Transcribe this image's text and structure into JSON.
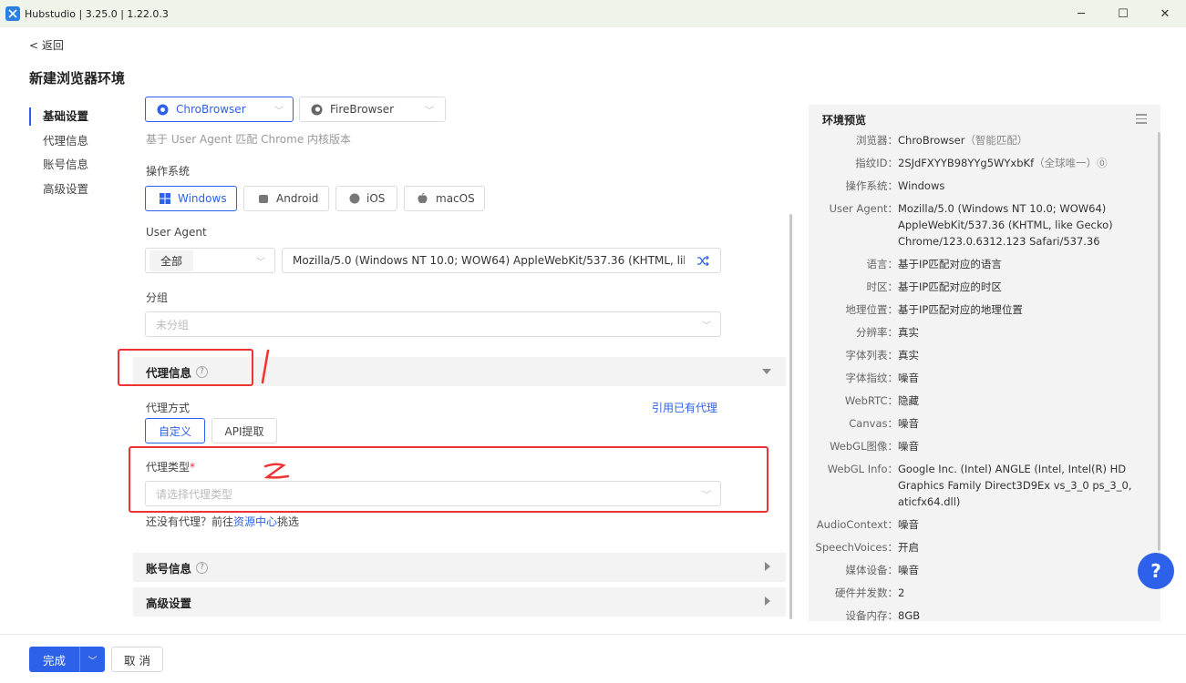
{
  "window": {
    "title": "Hubstudio | 3.25.0 | 1.22.0.3",
    "minimize": "─",
    "maximize": "☐",
    "close": "✕"
  },
  "nav": {
    "back": "< 返回",
    "page_title": "新建浏览器环境",
    "items": [
      "基础设置",
      "代理信息",
      "账号信息",
      "高级设置"
    ]
  },
  "browser": {
    "options": [
      "ChroBrowser",
      "FireBrowser"
    ],
    "hint": "基于 User Agent 匹配 Chrome 内核版本"
  },
  "os": {
    "label": "操作系统",
    "options": [
      "Windows",
      "Android",
      "iOS",
      "macOS"
    ]
  },
  "user_agent": {
    "label": "User Agent",
    "filter": "全部",
    "value": "Mozilla/5.0 (Windows NT 10.0; WOW64) AppleWebKit/537.36 (KHTML, like Gec"
  },
  "group": {
    "label": "分组",
    "placeholder": "未分组"
  },
  "proxy": {
    "section_title": "代理信息",
    "method_label": "代理方式",
    "use_existing": "引用已有代理",
    "methods": [
      "自定义",
      "API提取"
    ],
    "type_label": "代理类型",
    "required": "*",
    "type_placeholder": "请选择代理类型",
    "no_proxy_prefix": "还没有代理？前往",
    "no_proxy_link": "资源中心",
    "no_proxy_suffix": "挑选"
  },
  "annotations": {
    "mark1": "1",
    "mark2": "2"
  },
  "sections": {
    "account": "账号信息",
    "advanced": "高级设置"
  },
  "preview": {
    "title": "环境预览",
    "rows": [
      {
        "k": "浏览器：",
        "v": "ChroBrowser",
        "note": "（智能匹配）"
      },
      {
        "k": "指纹ID：",
        "v": "2SJdFXYYB98YYg5WYxbKf",
        "note": "（全球唯一）⓪"
      },
      {
        "k": "操作系统：",
        "v": "Windows",
        "note": ""
      },
      {
        "k": "User Agent：",
        "v": "Mozilla/5.0 (Windows NT 10.0; WOW64) AppleWebKit/537.36 (KHTML, like Gecko) Chrome/123.0.6312.123 Safari/537.36",
        "note": ""
      },
      {
        "k": "语言：",
        "v": "基于IP匹配对应的语言",
        "note": ""
      },
      {
        "k": "时区：",
        "v": "基于IP匹配对应的时区",
        "note": ""
      },
      {
        "k": "地理位置：",
        "v": "基于IP匹配对应的地理位置",
        "note": ""
      },
      {
        "k": "分辨率：",
        "v": "真实",
        "note": ""
      },
      {
        "k": "字体列表：",
        "v": "真实",
        "note": ""
      },
      {
        "k": "字体指纹：",
        "v": "噪音",
        "note": ""
      },
      {
        "k": "WebRTC：",
        "v": "隐藏",
        "note": ""
      },
      {
        "k": "Canvas：",
        "v": "噪音",
        "note": ""
      },
      {
        "k": "WebGL图像：",
        "v": "噪音",
        "note": ""
      },
      {
        "k": "WebGL Info：",
        "v": "Google Inc. (Intel) ANGLE (Intel, Intel(R) HD Graphics Family Direct3D9Ex vs_3_0 ps_3_0, aticfx64.dll)",
        "note": ""
      },
      {
        "k": "AudioContext：",
        "v": "噪音",
        "note": ""
      },
      {
        "k": "SpeechVoices：",
        "v": "开启",
        "note": ""
      },
      {
        "k": "媒体设备：",
        "v": "噪音",
        "note": ""
      },
      {
        "k": "硬件并发数：",
        "v": "2",
        "note": ""
      },
      {
        "k": "设备内存：",
        "v": "8GB",
        "note": ""
      }
    ]
  },
  "help": "?",
  "footer": {
    "done": "完成",
    "cancel": "取 消"
  },
  "colors": {
    "accent": "#2e61e9",
    "annotation": "#ee3333"
  }
}
